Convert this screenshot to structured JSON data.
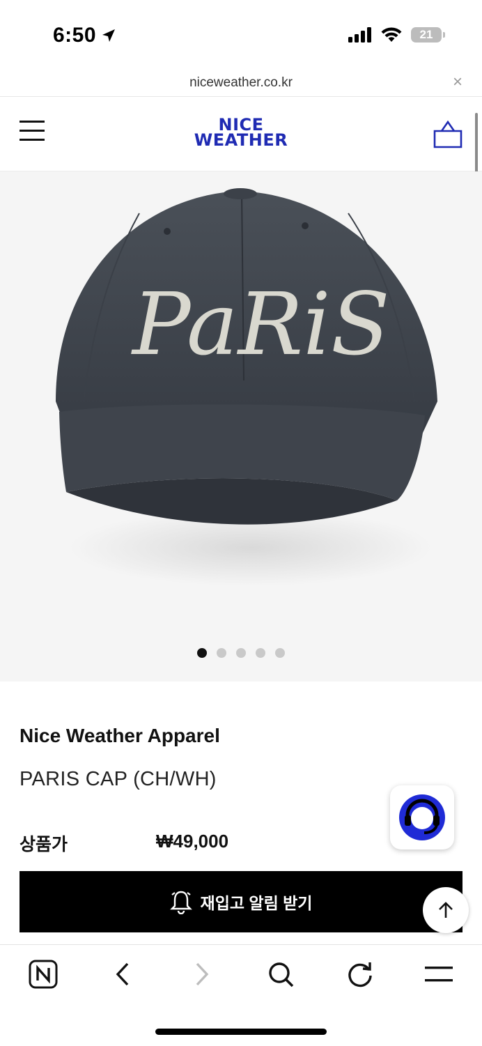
{
  "status_bar": {
    "time": "6:50",
    "battery": "21"
  },
  "browser": {
    "url": "niceweather.co.kr",
    "close_symbol": "×"
  },
  "header": {
    "logo_line1": "NICE",
    "logo_line2": "WEATHER"
  },
  "carousel": {
    "image_text": "PaRiS",
    "dots": 5,
    "active_index": 0
  },
  "product": {
    "brand": "Nice Weather Apparel",
    "name": "PARIS CAP (CH/WH)",
    "price_label": "상품가",
    "price": "₩49,000"
  },
  "actions": {
    "restock_label": "재입고 알림 받기"
  },
  "colors": {
    "brand_blue": "#1f2bb3",
    "button_black": "#000000",
    "chat_blue": "#1f2bd6"
  },
  "toolbar": {
    "icons": [
      "naver-n-icon",
      "back-icon",
      "forward-icon",
      "search-icon",
      "reload-icon",
      "menu-icon"
    ]
  }
}
